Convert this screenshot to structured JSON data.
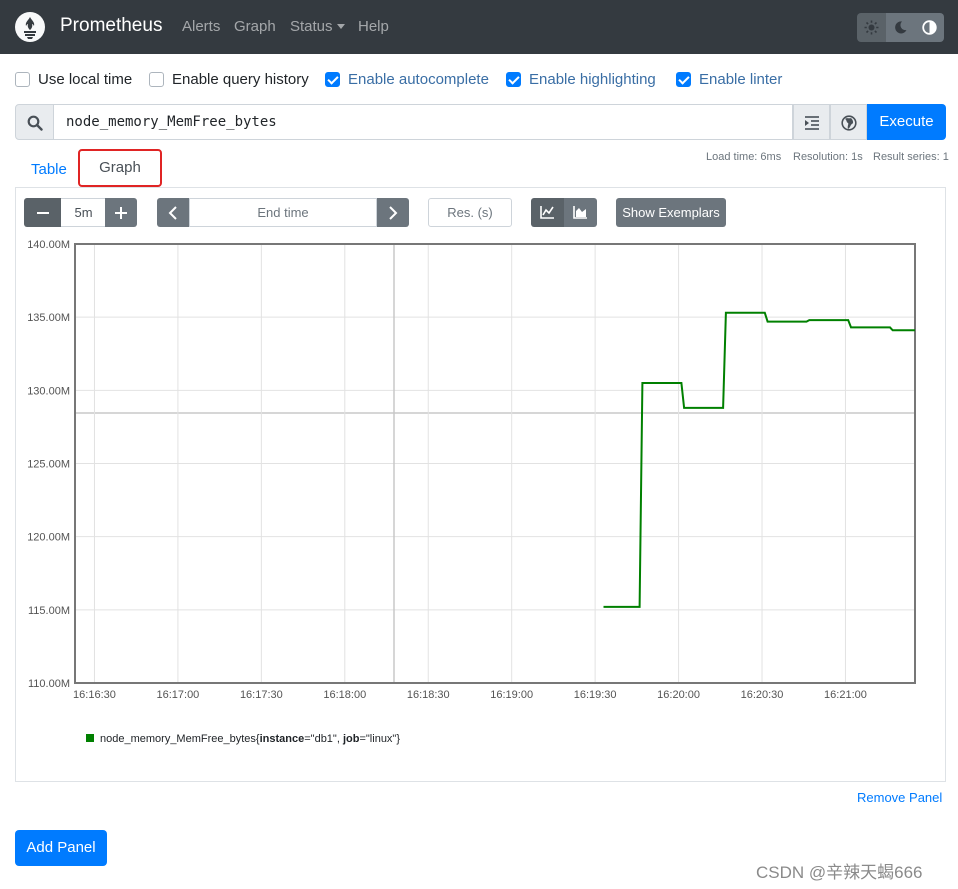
{
  "navbar": {
    "brand": "Prometheus",
    "links": [
      "Alerts",
      "Graph",
      "Status",
      "Help"
    ]
  },
  "options": [
    {
      "label": "Use local time",
      "checked": false
    },
    {
      "label": "Enable query history",
      "checked": false
    },
    {
      "label": "Enable autocomplete",
      "checked": true
    },
    {
      "label": "Enable highlighting",
      "checked": true
    },
    {
      "label": "Enable linter",
      "checked": true
    }
  ],
  "query": {
    "expression": "node_memory_MemFree_bytes",
    "execute_label": "Execute"
  },
  "tabs": {
    "table": "Table",
    "graph": "Graph"
  },
  "stats": {
    "load_time": "Load time: 6ms",
    "resolution": "Resolution: 1s",
    "result_series": "Result series: 1"
  },
  "controls": {
    "range": "5m",
    "end_time_placeholder": "End time",
    "res_placeholder": "Res. (s)",
    "show_exemplars": "Show Exemplars"
  },
  "chart_data": {
    "type": "line",
    "ylim": [
      110000000,
      140000000
    ],
    "yticks": [
      {
        "value": 110000000,
        "label": "110.00M"
      },
      {
        "value": 115000000,
        "label": "115.00M"
      },
      {
        "value": 120000000,
        "label": "120.00M"
      },
      {
        "value": 125000000,
        "label": "125.00M"
      },
      {
        "value": 130000000,
        "label": "130.00M"
      },
      {
        "value": 135000000,
        "label": "135.00M"
      },
      {
        "value": 140000000,
        "label": "140.00M"
      }
    ],
    "xlim": [
      "16:16:23",
      "16:21:25"
    ],
    "xticks": [
      "16:16:30",
      "16:17:00",
      "16:17:30",
      "16:18:00",
      "16:18:30",
      "16:19:00",
      "16:19:30",
      "16:20:00",
      "16:20:30",
      "16:21:00"
    ],
    "series": [
      {
        "name": "node_memory_MemFree_bytes{instance=\"db1\", job=\"linux\"}",
        "color": "#008000",
        "points": [
          [
            "16:19:33",
            115200000
          ],
          [
            "16:19:46",
            115200000
          ],
          [
            "16:19:47",
            130500000
          ],
          [
            "16:20:01",
            130500000
          ],
          [
            "16:20:02",
            128800000
          ],
          [
            "16:20:16",
            128800000
          ],
          [
            "16:20:17",
            135300000
          ],
          [
            "16:20:31",
            135300000
          ],
          [
            "16:20:32",
            134700000
          ],
          [
            "16:20:46",
            134700000
          ],
          [
            "16:20:47",
            134800000
          ],
          [
            "16:21:01",
            134800000
          ],
          [
            "16:21:02",
            134300000
          ],
          [
            "16:21:16",
            134300000
          ],
          [
            "16:21:17",
            134100000
          ],
          [
            "16:21:25",
            134100000
          ]
        ]
      }
    ],
    "legend": {
      "metric": "node_memory_MemFree_bytes",
      "instance_key": "instance",
      "instance_value": "\"db1\"",
      "job_key": "job",
      "job_value": "\"linux\""
    }
  },
  "remove_panel": "Remove Panel",
  "add_panel": "Add Panel",
  "watermark": "CSDN @辛辣天蝎666"
}
